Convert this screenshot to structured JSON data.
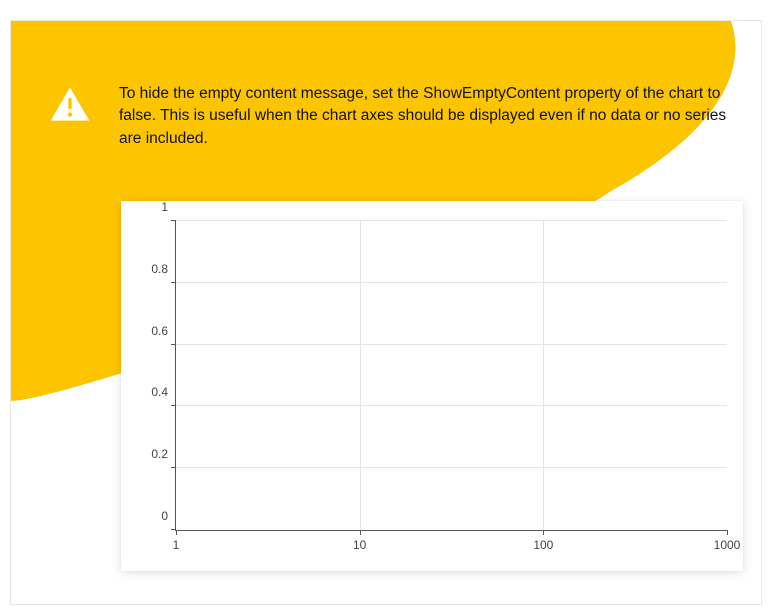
{
  "callout": {
    "text": "To hide the empty content message, set the ShowEmptyContent property of the chart to false. This is useful when the chart axes should be displayed even if no data or no series are included."
  },
  "chart_data": {
    "type": "line",
    "series": [],
    "title": "",
    "xlabel": "",
    "ylabel": "",
    "xscale": "log",
    "xlim": [
      1,
      1000
    ],
    "ylim": [
      0,
      1
    ],
    "xticks": [
      {
        "value": 1,
        "label": "1",
        "posPct": 0
      },
      {
        "value": 10,
        "label": "10",
        "posPct": 33.333
      },
      {
        "value": 100,
        "label": "100",
        "posPct": 66.666
      },
      {
        "value": 1000,
        "label": "1000",
        "posPct": 100
      }
    ],
    "yticks": [
      {
        "value": 0,
        "label": "0",
        "posPct": 0
      },
      {
        "value": 0.2,
        "label": "0.2",
        "posPct": 20
      },
      {
        "value": 0.4,
        "label": "0.4",
        "posPct": 40
      },
      {
        "value": 0.6,
        "label": "0.6",
        "posPct": 60
      },
      {
        "value": 0.8,
        "label": "0.8",
        "posPct": 80
      },
      {
        "value": 1,
        "label": "1",
        "posPct": 100
      }
    ]
  },
  "colors": {
    "accent": "#fdc500"
  }
}
